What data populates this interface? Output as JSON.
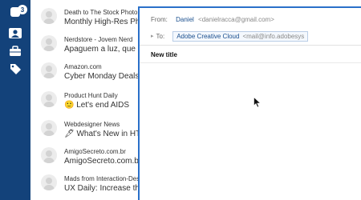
{
  "rail": {
    "badge": "3",
    "icons": [
      "inbox-icon",
      "contacts-icon",
      "briefcase-icon",
      "tag-icon"
    ]
  },
  "messages": [
    {
      "sender": "Death to The Stock Photo",
      "subject": "Monthly High-Res Photo"
    },
    {
      "sender": "Nerdstore - Jovem Nerd",
      "subject": "Apaguem a luz, que nós"
    },
    {
      "sender": "Amazon.com",
      "subject": "Cyber Monday Deals We"
    },
    {
      "sender": "Product Hunt Daily",
      "subject": "Let's end AIDS",
      "emoji": "🙂"
    },
    {
      "sender": "Webdesigner News",
      "subject": "What's New in HTML",
      "emoji": "🖋"
    },
    {
      "sender": "AmigoSecreto.com.br",
      "subject": "AmigoSecreto.com.br"
    },
    {
      "sender": "Mads from Interaction-Design",
      "subject": "UX Daily: Increase the Eff"
    }
  ],
  "compose": {
    "from_label": "From:",
    "from_name": "Daniel",
    "from_email": "<danielracca@gmail.com>",
    "to_label": "To:",
    "to_arrow": "▸",
    "recipient_name": "Adobe Creative Cloud",
    "recipient_email": "<mail@info.adobesys",
    "subject_value": "New title"
  },
  "colors": {
    "rail": "#13427a",
    "accent": "#2a70c9",
    "link": "#1a4f8e"
  }
}
